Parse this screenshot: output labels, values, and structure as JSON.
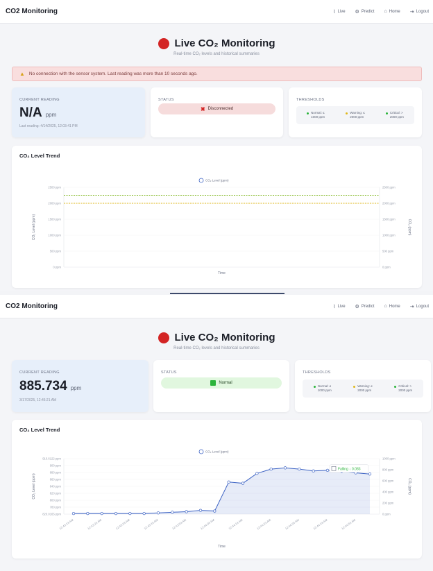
{
  "navbar": {
    "brand": "CO2 Monitoring",
    "items": [
      {
        "label": "Live",
        "icon": "chart-icon"
      },
      {
        "label": "Predict",
        "icon": "gear-icon"
      },
      {
        "label": "Home",
        "icon": "home-icon"
      },
      {
        "label": "Logout",
        "icon": "logout-icon"
      }
    ]
  },
  "header": {
    "title": "Live CO₂ Monitoring",
    "subtitle": "Real-time CO₂ levels and historical summaries"
  },
  "alert": {
    "text": "No connection with the sensor system. Last reading was more than 10 seconds ago."
  },
  "labels": {
    "current_reading": "CURRENT READING",
    "status": "STATUS",
    "thresholds": "THRESHOLDS",
    "chart_title": "CO₂ Level Trend"
  },
  "thresholds": [
    {
      "label": "Normal: ≤",
      "value": "1000 ppm",
      "color": "#2bb43b"
    },
    {
      "label": "Warning: ≤",
      "value": "2000 ppm",
      "color": "#e0b81c"
    },
    {
      "label": "Critical: >",
      "value": "2000 ppm",
      "color": "#2bb43b"
    }
  ],
  "snap1": {
    "value": "N/A",
    "unit": "ppm",
    "timestamp": "Last reading: 4/14/2025, 12:03:41 PM",
    "status": "Disconnected",
    "status_color": "#f6dcdc",
    "chart_data": {
      "type": "line",
      "legend": "CO₂ Level (ppm)",
      "xlabel": "Time",
      "ylabel": "CO₂ Level (ppm)",
      "y2label": "CO₂ (ppm)",
      "yticks": [
        "2500 ppm",
        "2000 ppm",
        "1500 ppm",
        "1000 ppm",
        "500 ppm",
        "0 ppm"
      ],
      "y2ticks": [
        "2500 ppm",
        "2000 ppm",
        "1500 ppm",
        "1000 ppm",
        "500 ppm",
        "0 ppm"
      ],
      "ylim": [
        0,
        2500
      ],
      "threshold_lines": [
        {
          "value": 2000,
          "color": "#e0b81c"
        },
        {
          "value": 2250,
          "color": "#8fbf3a"
        }
      ],
      "x": [],
      "values": []
    }
  },
  "snap2": {
    "value": "885.734",
    "unit": "ppm",
    "timestamp": "3/17/2025, 12:45:21 AM",
    "status": "Normal",
    "status_color": "#e1f7df",
    "trend_label": "Falling ↓ 0.083",
    "chart_data": {
      "type": "area",
      "legend": "CO₂ Level (ppm)",
      "xlabel": "Time",
      "ylabel": "CO₂ Level (ppm)",
      "y2label": "CO₂ (ppm)",
      "yticks": [
        "910.6122 ppm",
        "900 ppm",
        "880 ppm",
        "860 ppm",
        "840 ppm",
        "820 ppm",
        "800 ppm",
        "780 ppm",
        "820.0165 ppm"
      ],
      "y2ticks": [
        "1000 ppm",
        "800 ppm",
        "600 ppm",
        "400 ppm",
        "200 ppm",
        "0 ppm"
      ],
      "ylim": [
        820,
        910
      ],
      "x": [
        "12:43:13 AM",
        "12:43:18 AM",
        "12:43:23 AM",
        "12:43:28 AM",
        "12:43:33 AM",
        "12:43:38 AM",
        "12:43:43 AM",
        "12:43:48 AM",
        "12:43:53 AM",
        "12:43:58 AM",
        "12:44:03 AM",
        "12:44:08 AM",
        "12:44:13 AM",
        "12:44:18 AM",
        "12:44:23 AM",
        "12:44:28 AM",
        "12:44:33 AM",
        "12:44:38 AM",
        "12:44:43 AM",
        "12:44:48 AM",
        "12:44:53 AM",
        "12:44:58 AM"
      ],
      "xtick_labels": [
        "12:43:13 AM",
        "12:43:23 AM",
        "12:43:33 AM",
        "12:43:43 AM",
        "12:43:53 AM",
        "12:44:03 AM",
        "12:44:13 AM",
        "12:44:23 AM",
        "12:44:33 AM",
        "12:44:43 AM",
        "12:44:53 AM"
      ],
      "values": [
        821,
        821,
        821,
        821,
        821,
        821,
        822,
        823,
        824,
        826,
        825,
        872,
        870,
        886,
        893,
        895,
        893,
        890,
        891,
        889,
        887,
        885
      ]
    }
  }
}
